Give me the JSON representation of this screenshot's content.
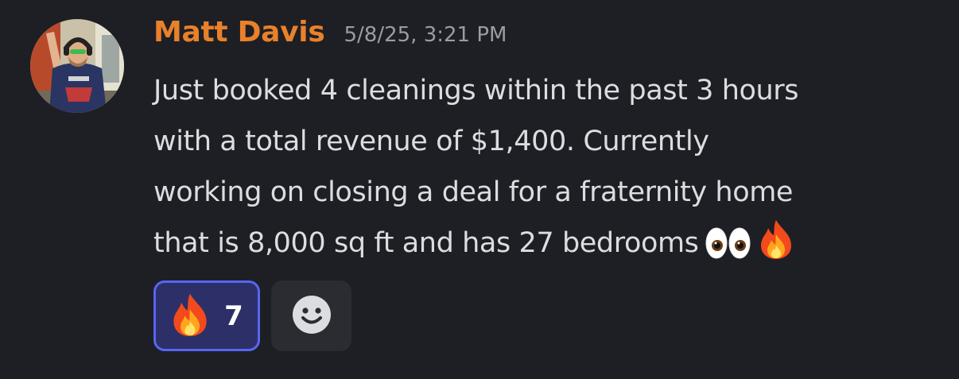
{
  "message": {
    "author": "Matt Davis",
    "author_color": "#e8812b",
    "timestamp": "5/8/25, 3:21 PM",
    "text_lines": [
      "Just booked 4 cleanings within the past 3 hours",
      "with a total revenue of $1,400. Currently",
      "working on closing a deal for a fraternity home",
      "that is 8,000 sq ft and has 27 bedrooms"
    ],
    "trailing_emojis": [
      "eyes-emoji",
      "fire-emoji"
    ],
    "avatar_icon": "user-avatar-photo"
  },
  "reactions": [
    {
      "emoji": "fire-emoji",
      "count": "7",
      "selected": true
    }
  ],
  "add_reaction_icon": "smiley-add-reaction-icon",
  "colors": {
    "background": "#1e1f24",
    "reaction_selected_bg": "#2d3068",
    "reaction_selected_border": "#5865f2",
    "add_reaction_bg": "#2b2c31",
    "timestamp": "#9b9ca3"
  }
}
